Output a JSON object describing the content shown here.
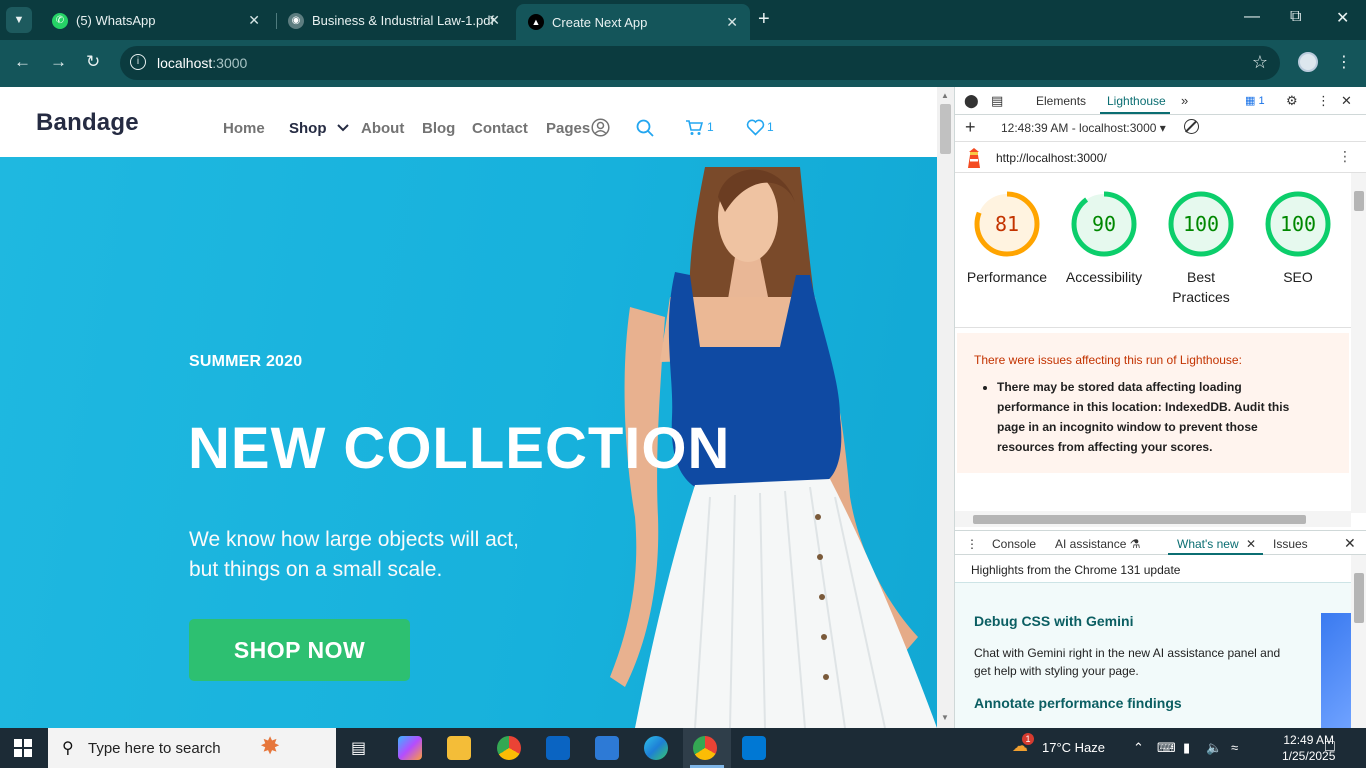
{
  "browser": {
    "tabs": [
      {
        "title": "(5) WhatsApp",
        "icon": "whatsapp-icon"
      },
      {
        "title": "Business & Industrial Law-1.pdf",
        "icon": "globe-icon"
      },
      {
        "title": "Create Next App",
        "icon": "nextjs-icon",
        "active": true
      }
    ],
    "url_host": "localhost",
    "url_port": ":3000"
  },
  "site": {
    "brand": "Bandage",
    "nav": [
      "Home",
      "Shop",
      "About",
      "Blog",
      "Contact",
      "Pages"
    ],
    "cart_count": "1",
    "wishlist_count": "1",
    "hero": {
      "kicker": "SUMMER 2020",
      "title": "NEW COLLECTION",
      "text_line1": "We know how large objects will act,",
      "text_line2": "but things on a small scale.",
      "cta": "SHOP NOW"
    },
    "colors": {
      "hero_bg": "#17b1dc",
      "cta": "#2dc071",
      "accent": "#23a6f0"
    }
  },
  "devtools": {
    "tabs": [
      "Elements",
      "Lighthouse"
    ],
    "active_tab": "Lighthouse",
    "issues_badge": "1",
    "run_label": "12:48:39 AM - localhost:3000 ▾",
    "report_url": "http://localhost:3000/",
    "scores": [
      {
        "label": "Performance",
        "value": 81,
        "color": "#ffa400",
        "text_color": "#c33300"
      },
      {
        "label": "Accessibility",
        "value": 90,
        "color": "#0cce6b",
        "text_color": "#008800"
      },
      {
        "label": "Best Practices",
        "value": 100,
        "color": "#0cce6b",
        "text_color": "#008800"
      },
      {
        "label": "SEO",
        "value": 100,
        "color": "#0cce6b",
        "text_color": "#008800"
      }
    ],
    "warning_title": "There were issues affecting this run of Lighthouse:",
    "warning_item": "There may be stored data affecting loading performance in this location: IndexedDB. Audit this page in an incognito window to prevent those resources from affecting your scores.",
    "drawer_tabs": [
      "Console",
      "AI assistance",
      "What's new",
      "Issues"
    ],
    "drawer_active": "What's new",
    "highlights": "Highlights from the Chrome 131 update",
    "article1_title": "Debug CSS with Gemini",
    "article1_text": "Chat with Gemini right in the new AI assistance panel and get help with styling your page.",
    "article2_title": "Annotate performance findings"
  },
  "taskbar": {
    "search_placeholder": "Type here to search",
    "weather": "17°C  Haze",
    "weather_badge": "1",
    "time": "12:49 AM",
    "date": "1/25/2025"
  }
}
